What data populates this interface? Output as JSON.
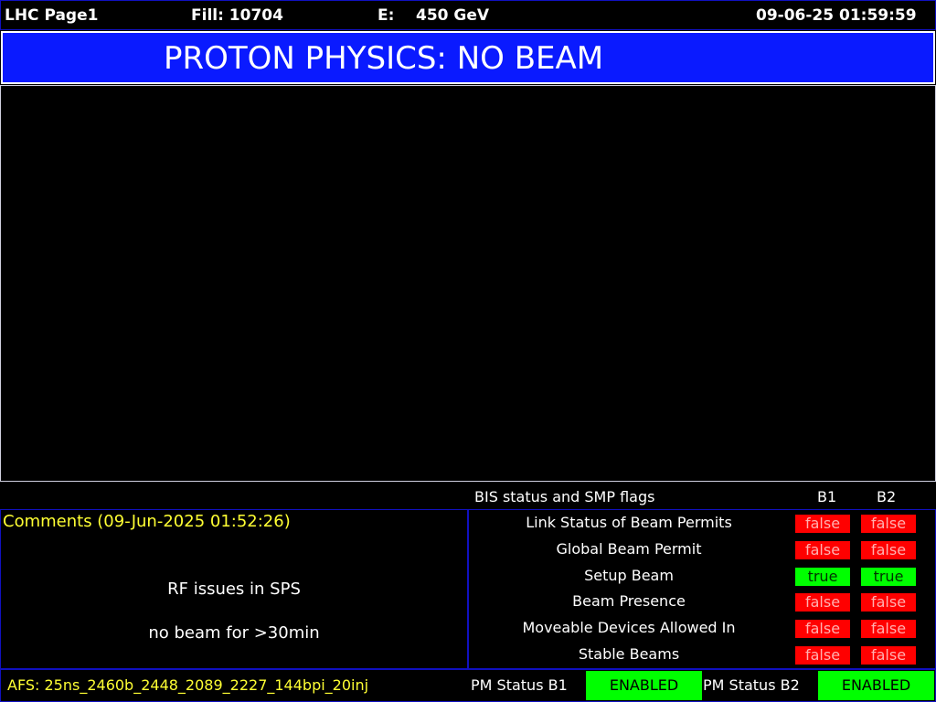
{
  "header": {
    "page_name": "LHC Page1",
    "fill": "Fill: 10704",
    "energy_label": "E:",
    "energy_value": "450 GeV",
    "datetime": "09-06-25 01:59:59"
  },
  "banner": {
    "title": "PROTON PHYSICS: NO BEAM",
    "color": "#0a1aff"
  },
  "bis": {
    "header": "BIS status and SMP flags",
    "col_b1": "B1",
    "col_b2": "B2",
    "rows": [
      {
        "label": "Link Status of Beam Permits",
        "b1": "false",
        "b2": "false"
      },
      {
        "label": "Global Beam Permit",
        "b1": "false",
        "b2": "false"
      },
      {
        "label": "Setup Beam",
        "b1": "true",
        "b2": "true"
      },
      {
        "label": "Beam Presence",
        "b1": "false",
        "b2": "false"
      },
      {
        "label": "Moveable Devices Allowed In",
        "b1": "false",
        "b2": "false"
      },
      {
        "label": "Stable Beams",
        "b1": "false",
        "b2": "false"
      }
    ]
  },
  "comments": {
    "title": "Comments (09-Jun-2025 01:52:26)",
    "lines": [
      "RF issues in SPS",
      "no beam for >30min"
    ]
  },
  "status_bar": {
    "afs": "AFS: 25ns_2460b_2448_2089_2227_144bpi_20inj",
    "pm_b1_label": "PM Status B1",
    "pm_b1_value": "ENABLED",
    "pm_b2_label": "PM Status B2",
    "pm_b2_value": "ENABLED"
  }
}
